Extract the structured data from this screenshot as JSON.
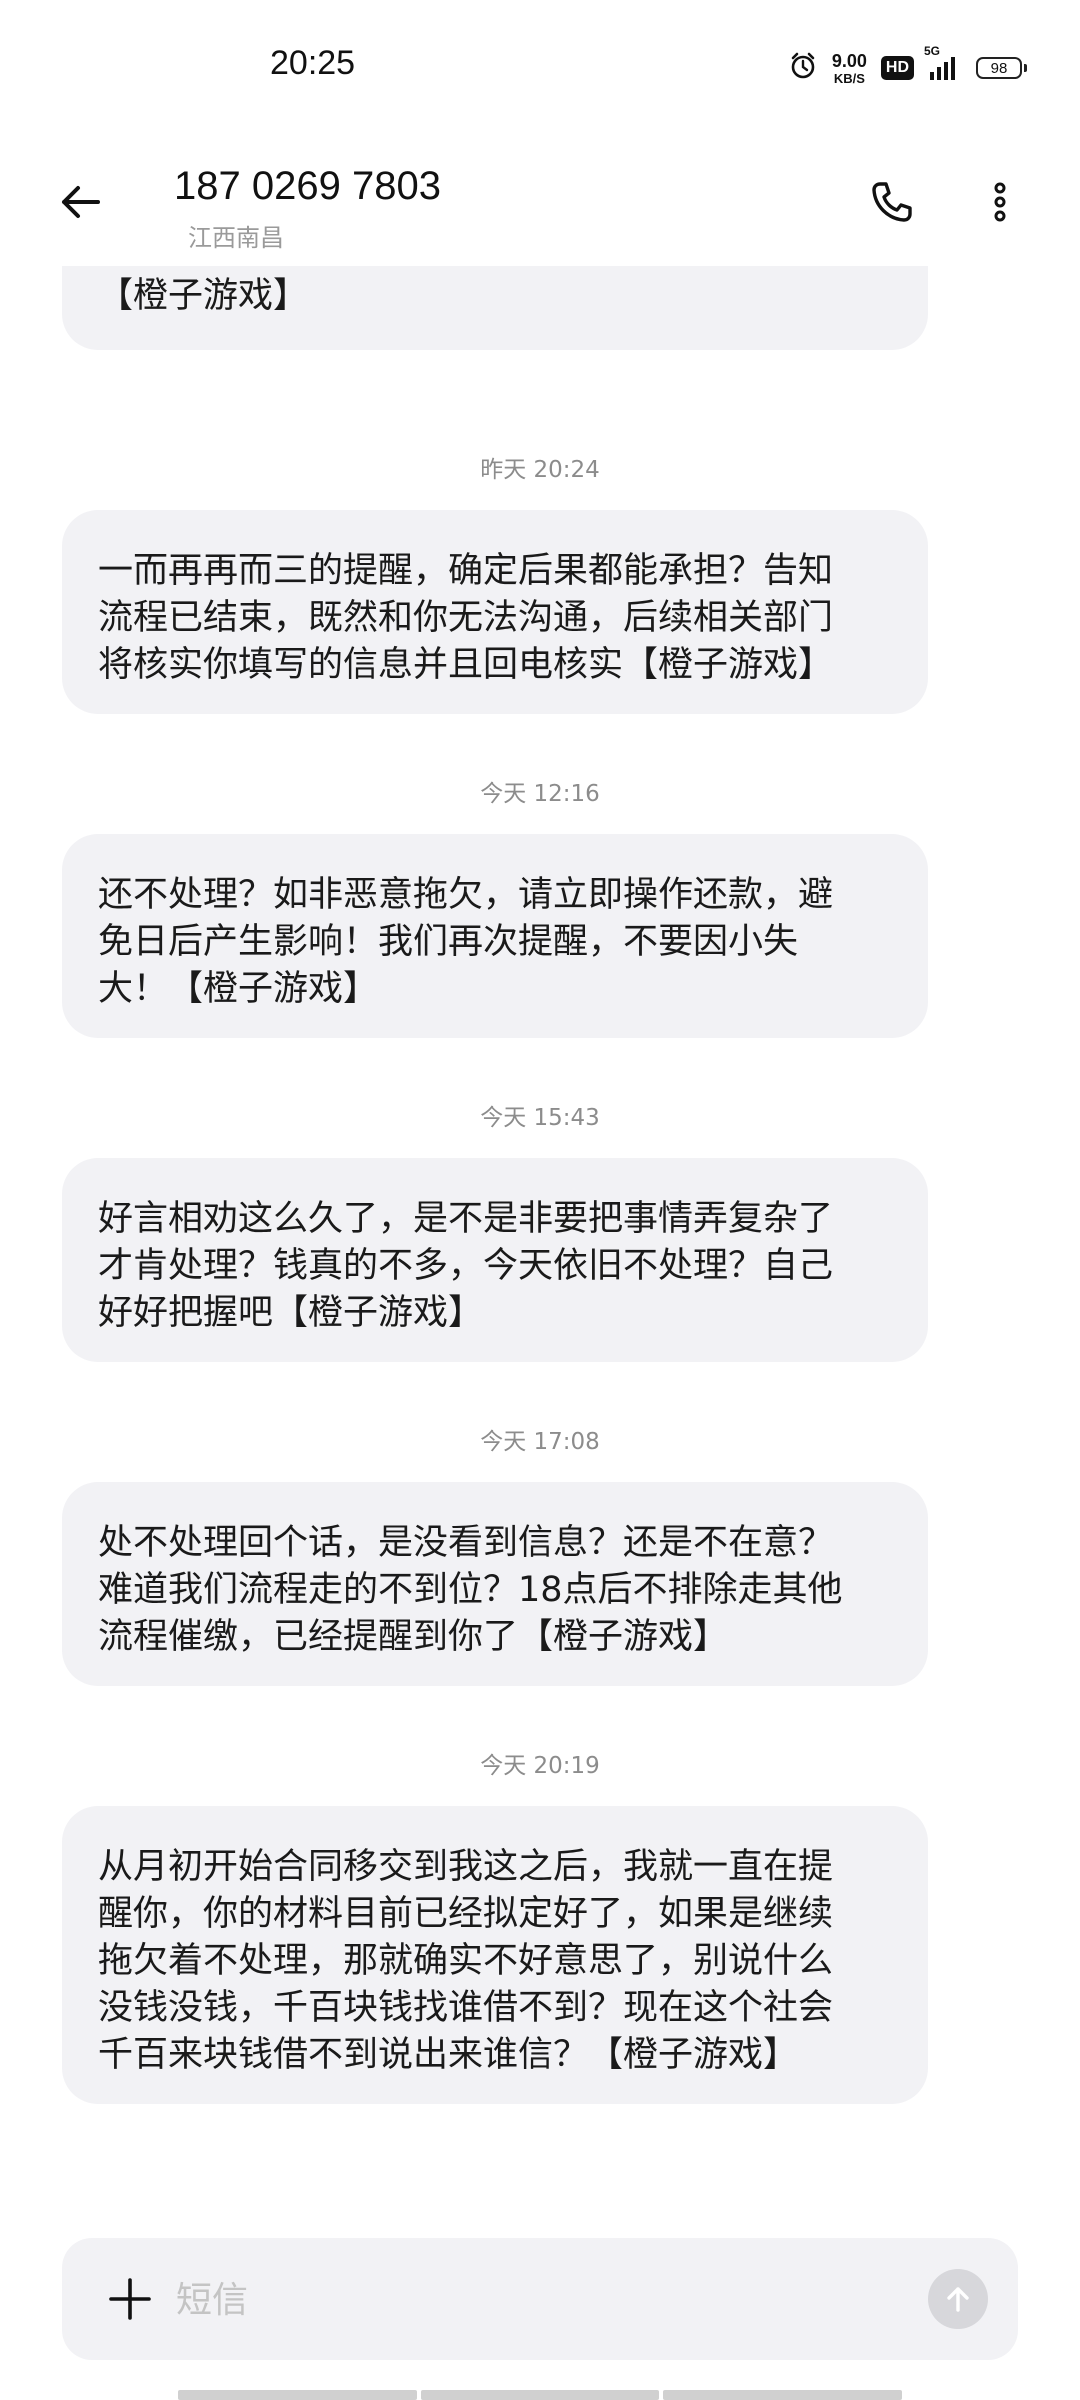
{
  "status_bar": {
    "time": "20:25",
    "net_speed_value": "9.00",
    "net_speed_unit": "KB/S",
    "hd_label": "HD",
    "network_type": "5G",
    "battery_level": "98",
    "icons": [
      "alarm-icon",
      "signal-icon"
    ]
  },
  "header": {
    "contact_number": "187 0269 7803",
    "location": "江西南昌",
    "icons": [
      "back-arrow-icon",
      "phone-icon",
      "more-vert-icon"
    ]
  },
  "messages": [
    {
      "text": "还要拖是吗？你可以继续拖，我们开始下一步\n【橙子游戏】"
    },
    {
      "timestamp": "昨天 20:24",
      "text": "一而再再而三的提醒，确定后果都能承担？告知\n流程已结束，既然和你无法沟通，后续相关部门\n将核实你填写的信息并且回电核实【橙子游戏】"
    },
    {
      "timestamp": "今天 12:16",
      "text": "还不处理？如非恶意拖欠，请立即操作还款，避\n免日后产生影响！我们再次提醒，不要因小失\n大！【橙子游戏】"
    },
    {
      "timestamp": "今天 15:43",
      "text": "好言相劝这么久了，是不是非要把事情弄复杂了\n才肯处理？钱真的不多，今天依旧不处理？自己\n好好把握吧【橙子游戏】"
    },
    {
      "timestamp": "今天 17:08",
      "text": "处不处理回个话，是没看到信息？还是不在意？\n难道我们流程走的不到位？18点后不排除走其他\n流程催缴，已经提醒到你了【橙子游戏】"
    },
    {
      "timestamp": "今天 20:19",
      "text": "从月初开始合同移交到我这之后，我就一直在提\n醒你，你的材料目前已经拟定好了，如果是继续\n拖欠着不处理，那就确实不好意思了，别说什么\n没钱没钱，千百块钱找谁借不到？现在这个社会\n千百来块钱借不到说出来谁信？【橙子游戏】"
    }
  ],
  "composer": {
    "placeholder": "短信",
    "icons": [
      "plus-icon",
      "send-arrow-icon"
    ]
  },
  "colors": {
    "bubble_bg": "#f2f2f5",
    "timestamp": "#8c8c8c",
    "location": "#9a9a9a",
    "placeholder": "#c4c4c4",
    "send_button": "#d7d7db"
  }
}
